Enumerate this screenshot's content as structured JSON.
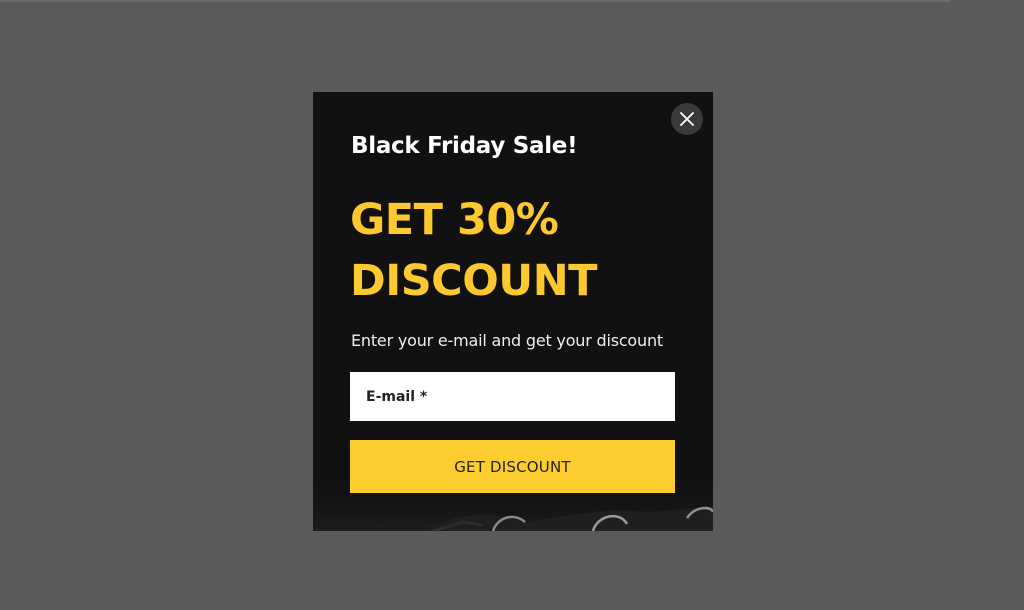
{
  "popup": {
    "subtitle": "Black Friday Sale!",
    "headline": "GET 30% DISCOUNT",
    "description": "Enter your e-mail and get your discount",
    "email_placeholder": "E-mail *",
    "email_value": "",
    "submit_label": "GET DISCOUNT",
    "close_icon": "close-icon"
  },
  "colors": {
    "overlay": "#5a5a5a",
    "popup_background": "#111111",
    "accent": "#fdcd2f",
    "text": "#ffffff"
  }
}
